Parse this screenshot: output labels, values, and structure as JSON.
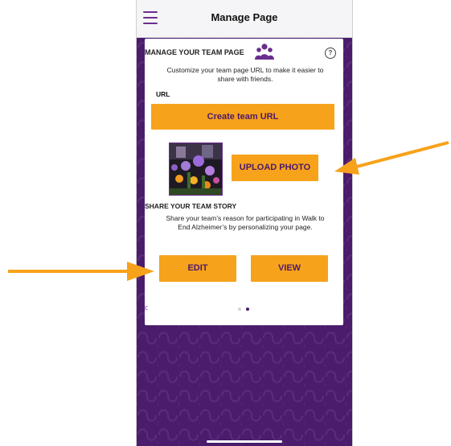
{
  "header": {
    "title": "Manage Page",
    "menu_icon": "hamburger-menu-icon"
  },
  "card": {
    "heading": "MANAGE YOUR TEAM PAGE",
    "team_icon": "team-people-icon",
    "help_icon": "question-circle-icon",
    "help_glyph": "?",
    "url_description": "Customize your team page URL to make it easier to share with friends.",
    "url_label": "URL",
    "create_url_button": "Create team URL",
    "upload_photo_button": "UPLOAD PHOTO",
    "story_heading": "SHARE YOUR TEAM STORY",
    "story_description": "Share your team’s reason for participating in Walk to End Alzheimer’s by personalizing your page.",
    "edit_button": "EDIT",
    "view_button": "VIEW",
    "pager_prev": "<",
    "pager": {
      "pages": 2,
      "active": 2
    }
  },
  "colors": {
    "accent": "#f7a21b",
    "brand_purple": "#4a1c6b",
    "button_text": "#4b1a6b",
    "annotation_arrow": "#f7a21b"
  }
}
